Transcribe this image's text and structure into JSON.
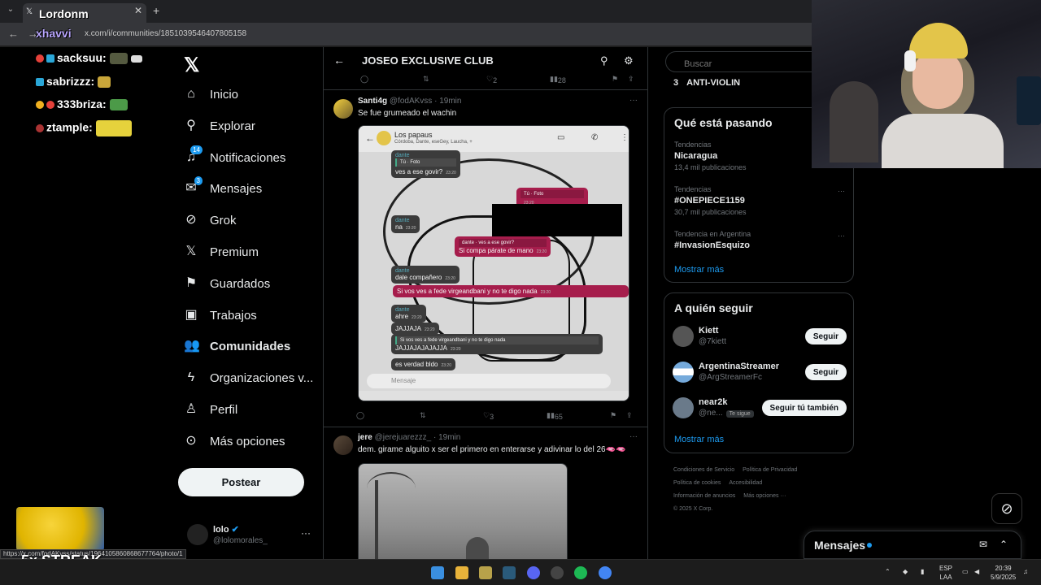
{
  "browser": {
    "tab_title": "Lordonm",
    "overlay_name": "xhavvi",
    "url": "x.com/i/communities/1851039546407805158"
  },
  "stream_chat": [
    {
      "user": "sacksuu:"
    },
    {
      "user": "sabrizzz:"
    },
    {
      "user": "333briza:"
    },
    {
      "user": "ztample:"
    }
  ],
  "nav": {
    "items": [
      {
        "label": "Inicio",
        "icon": "home-icon"
      },
      {
        "label": "Explorar",
        "icon": "search-icon"
      },
      {
        "label": "Notificaciones",
        "icon": "bell-icon",
        "badge": "14"
      },
      {
        "label": "Mensajes",
        "icon": "mail-icon",
        "badge": "3"
      },
      {
        "label": "Grok",
        "icon": "grok-icon"
      },
      {
        "label": "Premium",
        "icon": "x-icon"
      },
      {
        "label": "Guardados",
        "icon": "bookmark-icon"
      },
      {
        "label": "Trabajos",
        "icon": "briefcase-icon"
      },
      {
        "label": "Comunidades",
        "icon": "people-icon"
      },
      {
        "label": "Organizaciones v...",
        "icon": "lightning-icon"
      },
      {
        "label": "Perfil",
        "icon": "person-icon"
      },
      {
        "label": "Más opciones",
        "icon": "more-circle-icon"
      }
    ],
    "post_label": "Postear",
    "account": {
      "name": "lolo",
      "handle": "@lolomorales_"
    }
  },
  "community": {
    "title": "JOSEO EXCLUSIVE CLUB",
    "prev_actions": {
      "likes": "2",
      "views": "28"
    },
    "tweets": [
      {
        "name": "Santi4g",
        "handle": "@fodAKvss",
        "time": "· 19min",
        "text": "Se fue grumeado el wachin",
        "likes": "3",
        "views": "65",
        "chat": {
          "group": "Los papaus",
          "members": "Córdoba, Dante, eseGey, Laucha, +",
          "messages": [
            {
              "sender": "dante",
              "text": "ves a ese govir?",
              "quote": "Tú · Foto",
              "time": "23:20"
            },
            {
              "sender": "",
              "text": "",
              "quote": "Tú · Foto",
              "time": "23:20"
            },
            {
              "sender": "dante",
              "text": "na",
              "time": "23:20"
            },
            {
              "sender": "dante",
              "text": "Si compa párate de mano",
              "quote": "ves a ese govir?",
              "time": "23:20"
            },
            {
              "sender": "dante",
              "text": "dale compañero",
              "time": "23:20"
            },
            {
              "sender": "",
              "text": "Si vos ves a fede virgeandbani y no te digo nada",
              "time": "23:20"
            },
            {
              "sender": "dante",
              "text": "ahre",
              "time": "23:20"
            },
            {
              "sender": "",
              "text": "JAJJAJA",
              "time": "23:20"
            },
            {
              "sender": "",
              "text": "JAJJAJAJAJAJJA",
              "quote": "Si vos ves a fede virgeandbani y no te digo nada",
              "time": "23:20"
            },
            {
              "sender": "",
              "text": "es verdad bldo",
              "time": "23:20"
            }
          ],
          "input_placeholder": "Mensaje"
        }
      },
      {
        "name": "jere",
        "handle": "@jerejuarezzz_",
        "time": "· 19min",
        "text": "dem. girame alguito x ser el primero en enterarse y adivinar lo del 26🫦🫦"
      }
    ]
  },
  "sidebar": {
    "search_placeholder": "Buscar",
    "rank_item": {
      "num": "3",
      "label": "ANTI-VIOLIN"
    },
    "trends_title": "Qué está pasando",
    "trends": [
      {
        "context": "Tendencias",
        "title": "Nicaragua",
        "count": "13,4 mil publicaciones"
      },
      {
        "context": "Tendencias",
        "title": "#ONEPIECE1159",
        "count": "30,7 mil publicaciones"
      },
      {
        "context": "Tendencia en Argentina",
        "title": "#InvasionEsquizo",
        "count": ""
      }
    ],
    "show_more": "Mostrar más",
    "who_to_follow_title": "A quién seguir",
    "follow": [
      {
        "name": "Kiett",
        "handle": "@7kiett",
        "button": "Seguir"
      },
      {
        "name": "ArgentinaStreamer",
        "handle": "@ArgStreamerFc",
        "button": "Seguir"
      },
      {
        "name": "near2k",
        "handle": "@ne...",
        "tag": "Te sigue",
        "button": "Seguir tú también"
      }
    ],
    "show_more_2": "Mostrar más",
    "footer": [
      "Condiciones de Servicio",
      "Política de Privacidad",
      "Política de cookies",
      "Accesibilidad",
      "Información de anuncios",
      "Más opciones ···",
      "© 2025 X Corp."
    ]
  },
  "messages_drawer": {
    "title": "Mensajes"
  },
  "status_url": "https://x.com/fodAKvss/status/1964105860868677764/photo/1",
  "streak": "5x STREAK",
  "taskbar": {
    "lang": "ESP",
    "lang2": "LAA",
    "time": "20:39",
    "date": "5/9/2025"
  },
  "colors": {
    "accent": "#1d9bf0",
    "bubble_out": "#a61d4c",
    "bubble_in": "#3b3b3b"
  }
}
